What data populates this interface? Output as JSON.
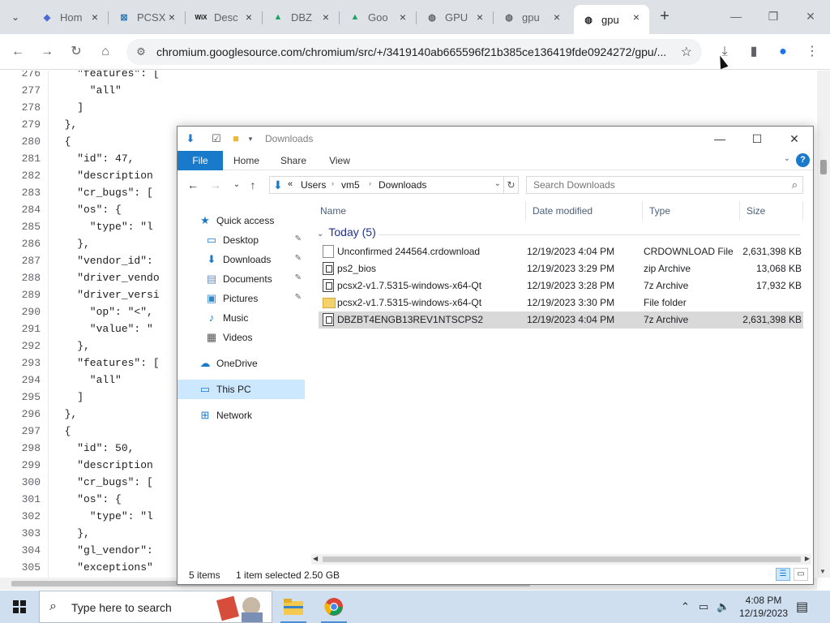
{
  "browser": {
    "tabs": [
      {
        "label": "Hom",
        "icon": "diamond-icon"
      },
      {
        "label": "PCSX",
        "icon": "pcsx-icon"
      },
      {
        "label": "Desc",
        "icon": "wix-icon"
      },
      {
        "label": "DBZ",
        "icon": "drive-icon"
      },
      {
        "label": "Goo",
        "icon": "drive-icon"
      },
      {
        "label": "GPU",
        "icon": "globe-icon"
      },
      {
        "label": "gpu",
        "icon": "globe-icon"
      },
      {
        "label": "gpu",
        "icon": "globe-icon"
      }
    ],
    "url": "chromium.googlesource.com/chromium/src/+/3419140ab665596f21b385ce136419fde0924272/gpu/..."
  },
  "code": {
    "lines": [
      {
        "n": "276",
        "t": "    \"features\": ["
      },
      {
        "n": "277",
        "t": "      \"all\""
      },
      {
        "n": "278",
        "t": "    ]"
      },
      {
        "n": "279",
        "t": "  },"
      },
      {
        "n": "280",
        "t": "  {"
      },
      {
        "n": "281",
        "t": "    \"id\": 47,"
      },
      {
        "n": "282",
        "t": "    \"description"
      },
      {
        "n": "283",
        "t": "    \"cr_bugs\": ["
      },
      {
        "n": "284",
        "t": "    \"os\": {"
      },
      {
        "n": "285",
        "t": "      \"type\": \"l"
      },
      {
        "n": "286",
        "t": "    },"
      },
      {
        "n": "287",
        "t": "    \"vendor_id\":"
      },
      {
        "n": "288",
        "t": "    \"driver_vendo"
      },
      {
        "n": "289",
        "t": "    \"driver_versi"
      },
      {
        "n": "290",
        "t": "      \"op\": \"<\","
      },
      {
        "n": "291",
        "t": "      \"value\": \""
      },
      {
        "n": "292",
        "t": "    },"
      },
      {
        "n": "293",
        "t": "    \"features\": ["
      },
      {
        "n": "294",
        "t": "      \"all\""
      },
      {
        "n": "295",
        "t": "    ]"
      },
      {
        "n": "296",
        "t": "  },"
      },
      {
        "n": "297",
        "t": "  {"
      },
      {
        "n": "298",
        "t": "    \"id\": 50,"
      },
      {
        "n": "299",
        "t": "    \"description"
      },
      {
        "n": "300",
        "t": "    \"cr_bugs\": ["
      },
      {
        "n": "301",
        "t": "    \"os\": {"
      },
      {
        "n": "302",
        "t": "      \"type\": \"l"
      },
      {
        "n": "303",
        "t": "    },"
      },
      {
        "n": "304",
        "t": "    \"gl_vendor\":"
      },
      {
        "n": "305",
        "t": "    \"exceptions\""
      }
    ]
  },
  "explorer": {
    "title": "Downloads",
    "ribbon_tabs": [
      "File",
      "Home",
      "Share",
      "View"
    ],
    "help": "?",
    "breadcrumb": {
      "prefix": "«",
      "parts": [
        "Users",
        "vm5",
        "Downloads"
      ]
    },
    "search_placeholder": "Search Downloads",
    "nav": {
      "quick_access": "Quick access",
      "desktop": "Desktop",
      "downloads": "Downloads",
      "documents": "Documents",
      "pictures": "Pictures",
      "music": "Music",
      "videos": "Videos",
      "onedrive": "OneDrive",
      "this_pc": "This PC",
      "network": "Network"
    },
    "columns": {
      "name": "Name",
      "date": "Date modified",
      "type": "Type",
      "size": "Size"
    },
    "group": "Today (5)",
    "files": [
      {
        "name": "Unconfirmed 244564.crdownload",
        "date": "12/19/2023 4:04 PM",
        "type": "CRDOWNLOAD File",
        "size": "2,631,398 KB",
        "icon": "doc"
      },
      {
        "name": "ps2_bios",
        "date": "12/19/2023 3:29 PM",
        "type": "zip Archive",
        "size": "13,068 KB",
        "icon": "zip"
      },
      {
        "name": "pcsx2-v1.7.5315-windows-x64-Qt",
        "date": "12/19/2023 3:28 PM",
        "type": "7z Archive",
        "size": "17,932 KB",
        "icon": "zip"
      },
      {
        "name": "pcsx2-v1.7.5315-windows-x64-Qt",
        "date": "12/19/2023 3:30 PM",
        "type": "File folder",
        "size": "",
        "icon": "folder"
      },
      {
        "name": "DBZBT4ENGB13REV1NTSCPS2",
        "date": "12/19/2023 4:04 PM",
        "type": "7z Archive",
        "size": "2,631,398 KB",
        "icon": "zip",
        "selected": true
      }
    ],
    "status": {
      "items": "5 items",
      "selected": "1 item selected",
      "size": "2.50 GB"
    }
  },
  "taskbar": {
    "search_placeholder": "Type here to search",
    "time": "4:08 PM",
    "date": "12/19/2023"
  },
  "colors": {
    "accent": "#1979ca",
    "selection": "#d9d9d9",
    "nav_selected": "#cce8ff",
    "taskbar": "#cfdff0"
  }
}
